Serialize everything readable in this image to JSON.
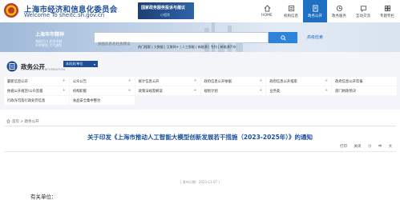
{
  "header": {
    "title": "上海市经济和信息化委员会",
    "subtitle": "Welcome To sheitc.sh.gov.cn",
    "promo_line1": "国家政务服务投诉与建议",
    "promo_line2": "小程序"
  },
  "nav": [
    {
      "label": "HOME",
      "icon": "home-icon"
    },
    {
      "label": "机构信息",
      "icon": "institution-icon"
    },
    {
      "label": "政务公开",
      "icon": "document-icon"
    },
    {
      "label": "政务服务",
      "icon": "service-icon"
    },
    {
      "label": "互动交流",
      "icon": "chat-icon"
    },
    {
      "label": "专题专栏",
      "icon": "topic-icon"
    }
  ],
  "nav_active_color": "#1f6fc2",
  "banner": {
    "slogan_title": "上海市市精神",
    "slogan_line1": "海纳百川 追求卓越",
    "slogan_line2": "开明睿智 大气谦和",
    "search_placeholder": "加强信息化社会建设",
    "advanced_search": "高级检索",
    "hotwords": "热门搜索 | 大数据 | 互联网+ | 人工智能 | 新能源 | 专利 | 新能源汽车"
  },
  "govt": {
    "title": "政务公开",
    "title_en": "GOVERNMENT INFORMATION",
    "unit_select": "本机关/单位"
  },
  "grid_items": [
    "最新信息公开",
    "公众公告",
    "统计信息公开",
    "政府信息公开依据",
    "政府信息公开指南",
    "政府信息公开年报",
    "依据公开规范/公众监督",
    "机构职能",
    "政策法规及解读",
    "规划计划",
    "业务类",
    "部门财政预决",
    "行政许可及行政处罚信息",
    "食品安全集中整治"
  ],
  "breadcrumb": "首页 > 政务公开",
  "article": {
    "title": "关于印发《上海市推动人工智能大模型创新发展若干措施（2023-2025年）》的通知",
    "tools": [
      "打印",
      "关闭",
      "小",
      "中",
      "大"
    ],
    "pubdate": "[ 发布日期：2023-11-07 ]",
    "salutation": "有关单位："
  },
  "colors": {
    "brand": "#1f4e95",
    "accent": "#2e84db",
    "title": "#1a4e9d"
  }
}
